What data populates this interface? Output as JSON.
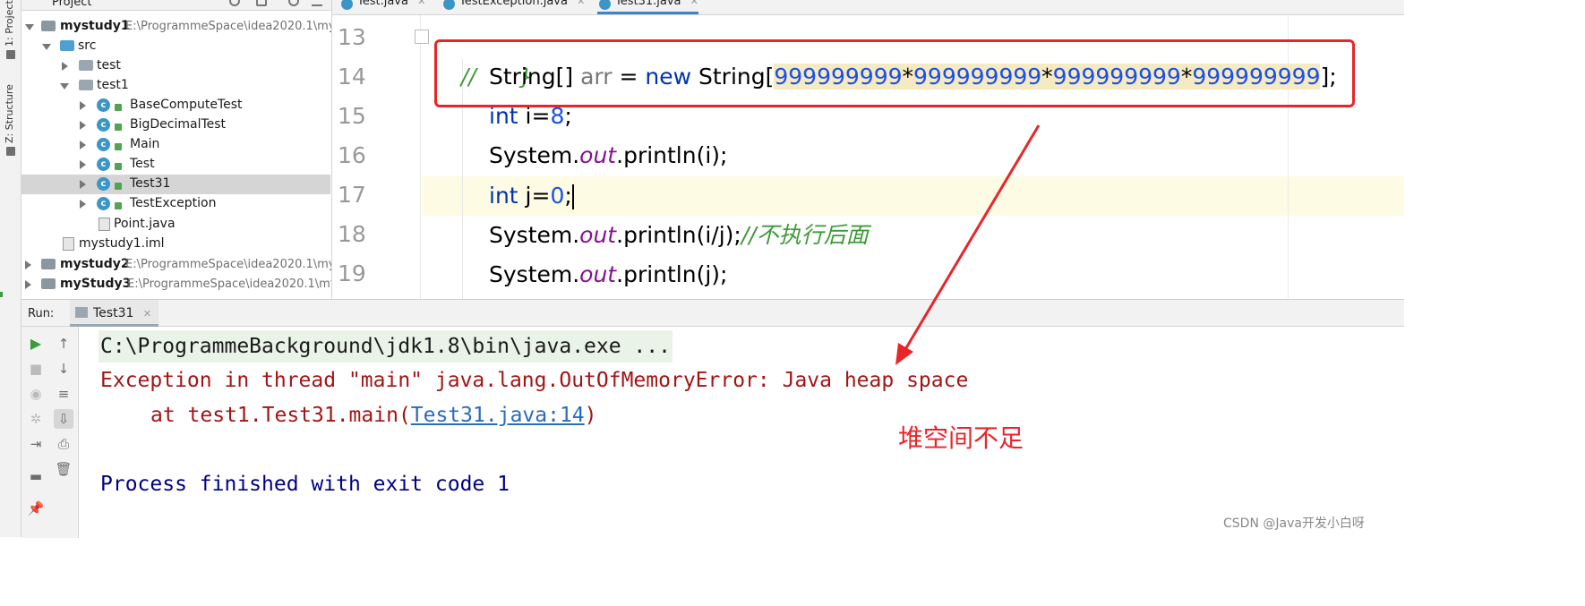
{
  "left_strip": {
    "project_tab": "1: Project",
    "structure_tab": "Z: Structure"
  },
  "project_panel": {
    "title": "Project",
    "tree": [
      {
        "label": "mystudy1",
        "bold": true,
        "path": "E:\\ProgrammeSpace\\idea2020.1\\my",
        "type": "module",
        "expanded": true
      },
      {
        "label": "src",
        "type": "src-folder",
        "expanded": true
      },
      {
        "label": "test",
        "type": "package",
        "expanded": false
      },
      {
        "label": "test1",
        "type": "package",
        "expanded": true
      },
      {
        "label": "BaseComputeTest",
        "type": "class"
      },
      {
        "label": "BigDecimalTest",
        "type": "class"
      },
      {
        "label": "Main",
        "type": "class"
      },
      {
        "label": "Test",
        "type": "class"
      },
      {
        "label": "Test31",
        "type": "class",
        "selected": true
      },
      {
        "label": "TestException",
        "type": "class"
      },
      {
        "label": "Point.java",
        "type": "file"
      },
      {
        "label": "mystudy1.iml",
        "type": "iml"
      },
      {
        "label": "mystudy2",
        "bold": true,
        "path": "E:\\ProgrammeSpace\\idea2020.1\\my",
        "type": "module",
        "expanded": false
      },
      {
        "label": "myStudy3",
        "bold": true,
        "path": "E:\\ProgrammeSpace\\idea2020.1\\my",
        "type": "module",
        "expanded": false
      }
    ]
  },
  "editor": {
    "tabs": [
      {
        "label": "Test.java",
        "active": false
      },
      {
        "label": "TestException.java",
        "active": false
      },
      {
        "label": "Test31.java",
        "active": true
      }
    ],
    "line_numbers": [
      "13",
      "14",
      "15",
      "16",
      "17",
      "18",
      "19"
    ],
    "code": {
      "l13": "//      }",
      "l14_type": "String[] ",
      "l14_var": "arr",
      "l14_eq": " = ",
      "l14_new": "new",
      "l14_ctor": " String[",
      "l14_n1": "999999999",
      "l14_times": "*",
      "l14_n2": "999999999",
      "l14_n3": "999999999",
      "l14_n4": "999999999",
      "l14_end": "];",
      "l15_kw": "int",
      "l15_rest": " i=",
      "l15_num": "8",
      "l15_end": ";",
      "l16_sys": "System.",
      "l16_out": "out",
      "l16_rest": ".println(i);",
      "l17_kw": "int",
      "l17_rest": " j=",
      "l17_num": "0",
      "l17_end": ";",
      "l18_sys": "System.",
      "l18_out": "out",
      "l18_rest": ".println(i/j);",
      "l18_comment": "//不执行后面",
      "l19_sys": "System.",
      "l19_out": "out",
      "l19_rest": ".println(j);"
    }
  },
  "run_panel": {
    "label": "Run:",
    "tab": "Test31",
    "console": {
      "cmd": "C:\\ProgrammeBackground\\jdk1.8\\bin\\java.exe ...",
      "error": "Exception in thread \"main\" java.lang.OutOfMemoryError: Java heap space",
      "at_prefix": "at test1.Test31.main(",
      "at_link": "Test31.java:14",
      "at_suffix": ")",
      "exit": "Process finished with exit code 1"
    }
  },
  "annotation": {
    "text": "堆空间不足",
    "color": "#e8262a"
  },
  "watermark": "CSDN @Java开发小白呀",
  "colors": {
    "keyword": "#0033b3",
    "number": "#1750eb",
    "field": "#871094",
    "comment": "#3d9a36",
    "error": "#a31515",
    "link": "#2a6bbf",
    "exit": "#000080"
  }
}
